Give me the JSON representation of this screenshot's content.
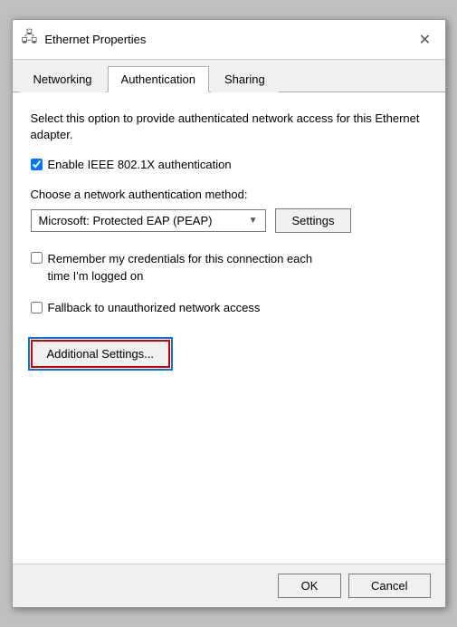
{
  "window": {
    "title": "Ethernet Properties",
    "icon": "🖧",
    "close_label": "✕"
  },
  "tabs": [
    {
      "id": "networking",
      "label": "Networking",
      "active": false
    },
    {
      "id": "authentication",
      "label": "Authentication",
      "active": true
    },
    {
      "id": "sharing",
      "label": "Sharing",
      "active": false
    }
  ],
  "content": {
    "description": "Select this option to provide authenticated network access for this Ethernet adapter.",
    "enable_checkbox": {
      "label": "Enable IEEE 802.1X authentication",
      "checked": true
    },
    "method_label": "Choose a network authentication method:",
    "method_dropdown": {
      "value": "Microsoft: Protected EAP (PEAP)"
    },
    "settings_btn_label": "Settings",
    "remember_checkbox": {
      "line1": "Remember my credentials for this connection each",
      "line2": "time I'm logged on",
      "checked": false
    },
    "fallback_checkbox": {
      "label": "Fallback to unauthorized network access",
      "checked": false
    },
    "additional_settings_label": "Additional Settings..."
  },
  "footer": {
    "ok_label": "OK",
    "cancel_label": "Cancel"
  }
}
